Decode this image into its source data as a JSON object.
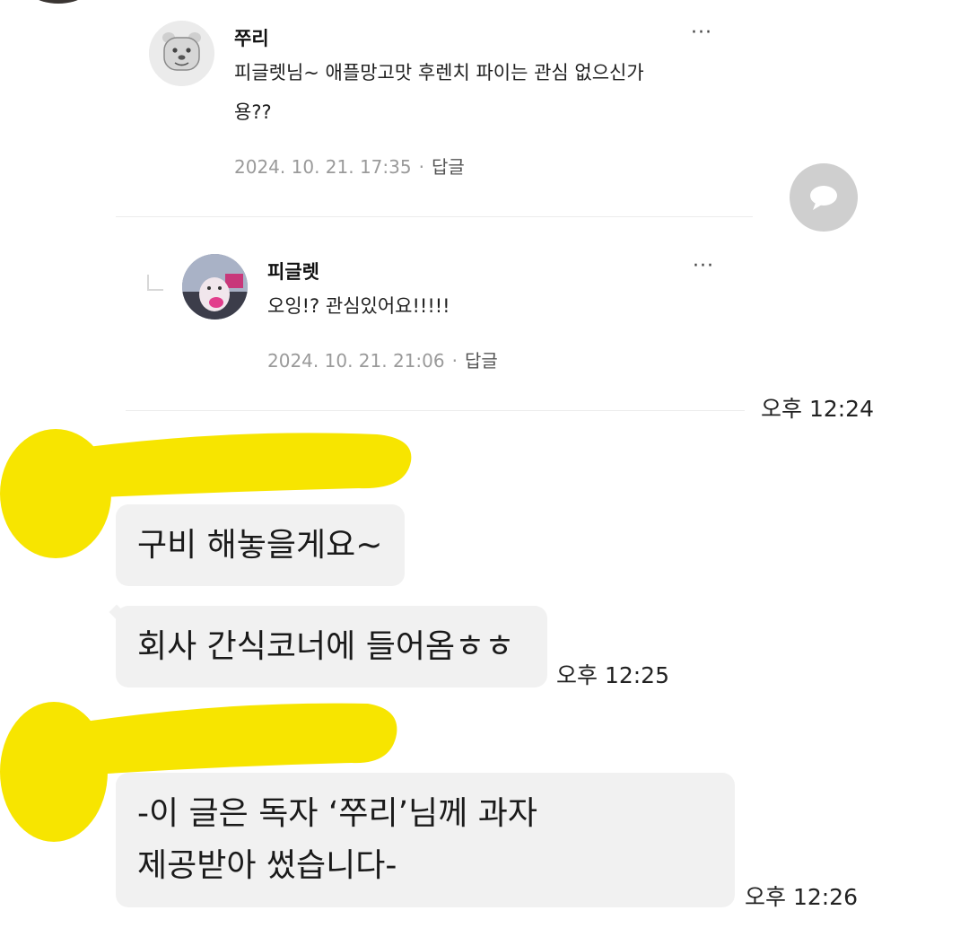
{
  "comments": [
    {
      "author": "쭈리",
      "text_line1": "피글렛님~ 애플망고맛 후렌치 파이는 관심 없으신가",
      "text_line2": "용??",
      "date": "2024. 10. 21. 17:35",
      "reply_label": "답글",
      "more": "···"
    },
    {
      "author": "피글렛",
      "text_line1": "오잉!? 관심있어요!!!!!",
      "date": "2024. 10. 21. 21:06",
      "reply_label": "답글",
      "more": "···"
    }
  ],
  "chat": {
    "time1": "오후 12:24",
    "messages": [
      {
        "text_line1": "구비 해놓을게요~"
      },
      {
        "text_line1": "회사 간식코너에 들어옴ㅎㅎ",
        "time": "오후 12:25"
      },
      {
        "text_line1": "-이 글은 독자 ‘쭈리’님께 과자",
        "text_line2": "제공받아 썼습니다-",
        "time": "오후 12:26"
      }
    ]
  },
  "colors": {
    "highlight": "#f7e500",
    "bubble": "#f1f1f1",
    "meta": "#9a9a9a"
  },
  "icons": {
    "fab": "speech-bubble-icon",
    "more": "more-dots-icon",
    "reply_indent": "reply-indent-icon"
  }
}
